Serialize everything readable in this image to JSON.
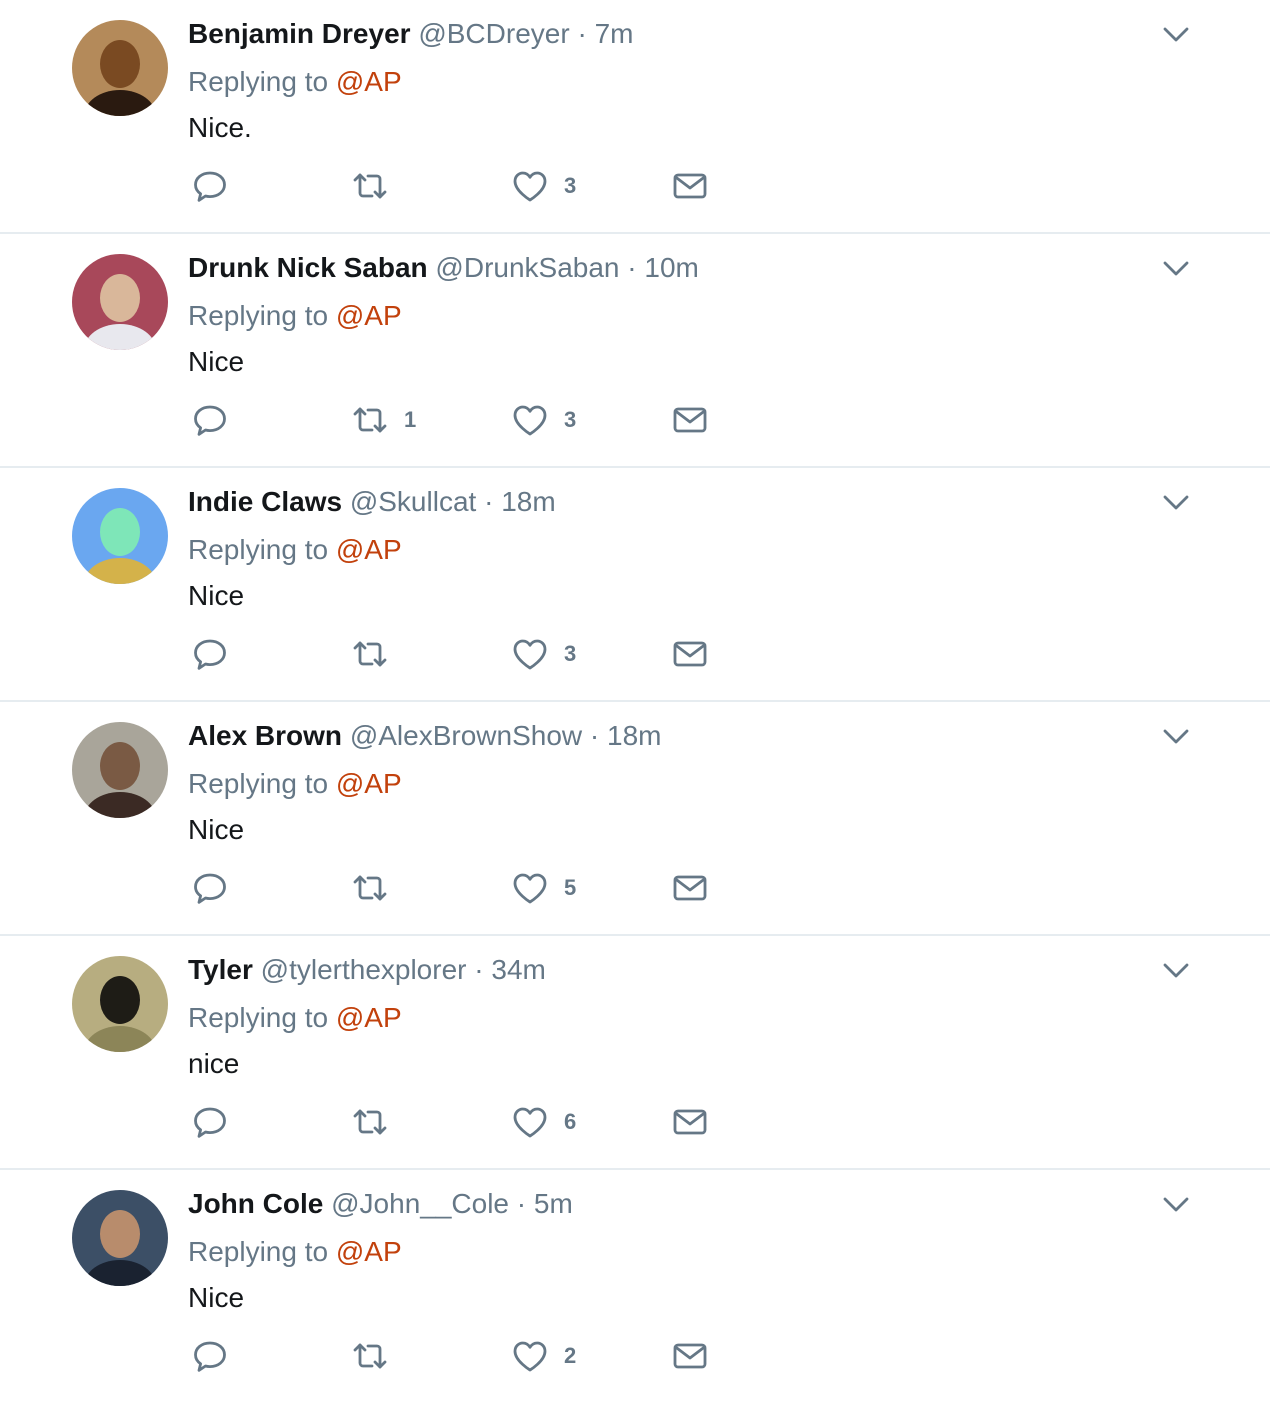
{
  "tweets": [
    {
      "name": "Benjamin Dreyer",
      "handle": "@BCDreyer",
      "dot": "·",
      "time": "7m",
      "replying_prefix": "Replying to",
      "replying_to": "@AP",
      "text": "Nice.",
      "reply_count": "",
      "retweet_count": "",
      "like_count": "3",
      "avatar_colors": {
        "bg": "#b48a5a",
        "face": "#7a4a22",
        "accent": "#2a1a10"
      }
    },
    {
      "name": "Drunk Nick Saban",
      "handle": "@DrunkSaban",
      "dot": "·",
      "time": "10m",
      "replying_prefix": "Replying to",
      "replying_to": "@AP",
      "text": "Nice",
      "reply_count": "",
      "retweet_count": "1",
      "like_count": "3",
      "avatar_colors": {
        "bg": "#a8485a",
        "face": "#d9b79a",
        "accent": "#e8e8ee"
      }
    },
    {
      "name": "Indie Claws",
      "handle": "@Skullcat",
      "dot": "·",
      "time": "18m",
      "replying_prefix": "Replying to",
      "replying_to": "@AP",
      "text": "Nice",
      "reply_count": "",
      "retweet_count": "",
      "like_count": "3",
      "avatar_colors": {
        "bg": "#6aa7f0",
        "face": "#7ee6b8",
        "accent": "#d4b24a"
      }
    },
    {
      "name": "Alex Brown",
      "handle": "@AlexBrownShow",
      "dot": "·",
      "time": "18m",
      "replying_prefix": "Replying to",
      "replying_to": "@AP",
      "text": "Nice",
      "reply_count": "",
      "retweet_count": "",
      "like_count": "5",
      "avatar_colors": {
        "bg": "#a9a59a",
        "face": "#7a5a44",
        "accent": "#3b2a24"
      }
    },
    {
      "name": "Tyler",
      "handle": "@tylerthexplorer",
      "dot": "·",
      "time": "34m",
      "replying_prefix": "Replying to",
      "replying_to": "@AP",
      "text": "nice",
      "reply_count": "",
      "retweet_count": "",
      "like_count": "6",
      "avatar_colors": {
        "bg": "#b7ad80",
        "face": "#1e1c16",
        "accent": "#8c8558"
      }
    },
    {
      "name": "John Cole",
      "handle": "@John__Cole",
      "dot": "·",
      "time": "5m",
      "replying_prefix": "Replying to",
      "replying_to": "@AP",
      "text": "Nice",
      "reply_count": "",
      "retweet_count": "",
      "like_count": "2",
      "avatar_colors": {
        "bg": "#3c4f66",
        "face": "#b88c6c",
        "accent": "#1a2230"
      }
    }
  ],
  "icons": {
    "reply": "reply-icon",
    "retweet": "retweet-icon",
    "like": "heart-icon",
    "message": "envelope-icon",
    "more": "chevron-down-icon"
  },
  "colors": {
    "mention": "#c2410c",
    "muted": "#657786",
    "name": "#14171a",
    "divider": "#e6ecf0"
  }
}
